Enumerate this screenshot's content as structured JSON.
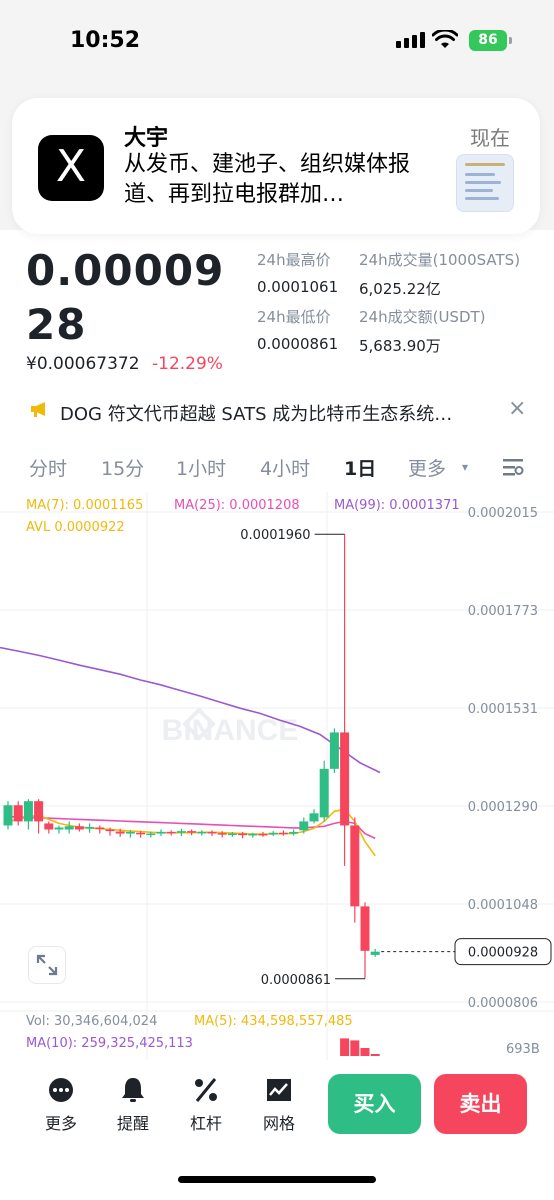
{
  "status": {
    "time": "10:52",
    "battery": "86"
  },
  "notification": {
    "app_logo": "X",
    "title": "大宇",
    "time": "现在",
    "body": "从发币、建池子、组织媒体报道、再到拉电报群加…"
  },
  "price": {
    "main": "0.0000928",
    "cny": "¥0.00067372",
    "change": "-12.29%"
  },
  "stats": {
    "high_label": "24h最高价",
    "high_value": "0.0001061",
    "vol_label": "24h成交量(1000SATS)",
    "vol_value": "6,025.22亿",
    "low_label": "24h最低价",
    "low_value": "0.0000861",
    "turnover_label": "24h成交额(USDT)",
    "turnover_value": "5,683.90万"
  },
  "news": {
    "text": "DOG 符文代币超越 SATS 成为比特币生态系统…",
    "close": "×"
  },
  "tabs": [
    {
      "label": "分时"
    },
    {
      "label": "15分"
    },
    {
      "label": "1小时"
    },
    {
      "label": "4小时"
    },
    {
      "label": "1日"
    },
    {
      "label": "更多"
    }
  ],
  "legend": {
    "ma7": "MA(7): 0.0001165",
    "ma25": "MA(25): 0.0001208",
    "ma99": "MA(99): 0.0001371",
    "avl": "AVL 0.0000922",
    "vol": "Vol: 30,346,604,024",
    "vol_ma5": "MA(5): 434,598,557,485",
    "vol_ma10": "MA(10): 259,325,425,113",
    "vol_axis": "693B"
  },
  "colors": {
    "up": "#2ebd85",
    "down": "#f6465d",
    "ma7": "#f0b90b",
    "ma25": "#e84fb3",
    "ma99": "#9b59d0"
  },
  "chart_data": {
    "type": "candlestick",
    "watermark": "BINANCE",
    "y_ticks": [
      "0.0002015",
      "0.0001773",
      "0.0001531",
      "0.0001290",
      "0.0001048",
      "0.0000806"
    ],
    "ylim": [
      8.06e-05,
      0.0002015
    ],
    "annotations": {
      "high": "0.0001960",
      "low": "0.0000861",
      "last": "0.0000928"
    },
    "candles": [
      {
        "o": 0.000124,
        "c": 0.000129,
        "h": 0.00013,
        "l": 0.000123
      },
      {
        "o": 0.000129,
        "c": 0.000125,
        "h": 0.00013,
        "l": 0.000124
      },
      {
        "o": 0.000125,
        "c": 0.00013,
        "h": 0.0001305,
        "l": 0.000123
      },
      {
        "o": 0.00013,
        "c": 0.000125,
        "h": 0.0001305,
        "l": 0.000122
      },
      {
        "o": 0.0001245,
        "c": 0.000123,
        "h": 0.000125,
        "l": 0.000122
      },
      {
        "o": 0.000123,
        "c": 0.0001235,
        "h": 0.000124,
        "l": 0.000122
      },
      {
        "o": 0.000123,
        "c": 0.0001238,
        "h": 0.000125,
        "l": 0.000122
      },
      {
        "o": 0.0001238,
        "c": 0.000123,
        "h": 0.0001245,
        "l": 0.0001225
      },
      {
        "o": 0.0001232,
        "c": 0.0001236,
        "h": 0.0001245,
        "l": 0.0001222
      },
      {
        "o": 0.0001235,
        "c": 0.0001232,
        "h": 0.000124,
        "l": 0.000122
      },
      {
        "o": 0.000123,
        "c": 0.0001226,
        "h": 0.0001235,
        "l": 0.0001215
      },
      {
        "o": 0.0001225,
        "c": 0.000122,
        "h": 0.0001232,
        "l": 0.0001212
      },
      {
        "o": 0.000122,
        "c": 0.0001224,
        "h": 0.0001228,
        "l": 0.000121
      },
      {
        "o": 0.0001222,
        "c": 0.0001218,
        "h": 0.0001226,
        "l": 0.000121
      },
      {
        "o": 0.0001218,
        "c": 0.000122,
        "h": 0.0001225,
        "l": 0.000121
      },
      {
        "o": 0.000122,
        "c": 0.0001224,
        "h": 0.000123,
        "l": 0.0001214
      },
      {
        "o": 0.0001224,
        "c": 0.0001222,
        "h": 0.0001228,
        "l": 0.0001215
      },
      {
        "o": 0.0001222,
        "c": 0.0001226,
        "h": 0.0001232,
        "l": 0.0001214
      },
      {
        "o": 0.0001226,
        "c": 0.0001223,
        "h": 0.000123,
        "l": 0.0001216
      },
      {
        "o": 0.0001222,
        "c": 0.0001224,
        "h": 0.0001228,
        "l": 0.0001215
      },
      {
        "o": 0.0001224,
        "c": 0.0001221,
        "h": 0.0001228,
        "l": 0.0001214
      },
      {
        "o": 0.0001221,
        "c": 0.0001218,
        "h": 0.0001226,
        "l": 0.000121
      },
      {
        "o": 0.0001218,
        "c": 0.000122,
        "h": 0.0001224,
        "l": 0.0001212
      },
      {
        "o": 0.000122,
        "c": 0.0001216,
        "h": 0.0001224,
        "l": 0.0001208
      },
      {
        "o": 0.0001216,
        "c": 0.0001219,
        "h": 0.0001222,
        "l": 0.000121
      },
      {
        "o": 0.0001219,
        "c": 0.0001218,
        "h": 0.0001224,
        "l": 0.0001212
      },
      {
        "o": 0.0001218,
        "c": 0.0001222,
        "h": 0.0001226,
        "l": 0.0001214
      },
      {
        "o": 0.0001222,
        "c": 0.000122,
        "h": 0.0001228,
        "l": 0.0001215
      },
      {
        "o": 0.000122,
        "c": 0.0001224,
        "h": 0.000123,
        "l": 0.0001215
      },
      {
        "o": 0.0001228,
        "c": 0.000125,
        "h": 0.000126,
        "l": 0.000122
      },
      {
        "o": 0.000125,
        "c": 0.000127,
        "h": 0.000128,
        "l": 0.0001245
      },
      {
        "o": 0.000126,
        "c": 0.000138,
        "h": 0.00014,
        "l": 0.000125
      },
      {
        "o": 0.000138,
        "c": 0.000147,
        "h": 0.000148,
        "l": 0.000137
      },
      {
        "o": 0.000147,
        "c": 0.000124,
        "h": 0.000196,
        "l": 0.000114
      },
      {
        "o": 0.000124,
        "c": 0.000104,
        "h": 0.000126,
        "l": 0.0001
      },
      {
        "o": 0.000104,
        "c": 9.3e-05,
        "h": 0.000105,
        "l": 8.61e-05
      },
      {
        "o": 9.2e-05,
        "c": 9.28e-05,
        "h": 9.35e-05,
        "l": 9.15e-05
      }
    ],
    "ma7": [
      0.000125,
      0.0001255,
      0.0001262,
      0.0001265,
      0.0001255,
      0.0001245,
      0.000124,
      0.0001236,
      0.0001234,
      0.0001232,
      0.000123,
      0.0001228,
      0.0001226,
      0.0001225,
      0.0001223,
      0.0001222,
      0.0001222,
      0.0001222,
      0.0001222,
      0.0001223,
      0.0001223,
      0.0001222,
      0.0001221,
      0.000122,
      0.0001219,
      0.0001219,
      0.0001219,
      0.000122,
      0.000122,
      0.0001225,
      0.0001233,
      0.000125,
      0.0001275,
      0.000128,
      0.000125,
      0.00012,
      0.0001165
    ],
    "ma25": [
      0.0001262,
      0.0001261,
      0.000126,
      0.0001259,
      0.0001258,
      0.0001257,
      0.0001256,
      0.0001255,
      0.0001254,
      0.0001253,
      0.0001252,
      0.0001251,
      0.000125,
      0.0001249,
      0.0001248,
      0.0001247,
      0.0001246,
      0.0001245,
      0.0001244,
      0.0001243,
      0.0001242,
      0.0001241,
      0.000124,
      0.0001239,
      0.0001238,
      0.0001237,
      0.0001236,
      0.0001235,
      0.0001234,
      0.0001234,
      0.0001236,
      0.0001238,
      0.0001245,
      0.000125,
      0.0001245,
      0.000122,
      0.0001208
    ],
    "ma99_x": [
      0,
      20,
      40,
      60,
      80,
      100,
      120,
      140,
      160,
      180,
      200,
      220,
      240,
      260,
      280,
      300,
      320,
      340,
      360,
      380
    ],
    "ma99_y": [
      0.000168,
      0.000167,
      0.000166,
      0.0001648,
      0.0001636,
      0.0001625,
      0.0001614,
      0.00016,
      0.0001588,
      0.0001574,
      0.000156,
      0.0001545,
      0.000153,
      0.0001517,
      0.00015,
      0.0001485,
      0.0001465,
      0.000143,
      0.0001395,
      0.0001371
    ],
    "volumes_last": [
      0.88,
      0.78,
      0.4,
      0.1
    ]
  },
  "bottom": {
    "items": [
      {
        "label": "更多"
      },
      {
        "label": "提醒"
      },
      {
        "label": "杠杆"
      },
      {
        "label": "网格"
      }
    ],
    "buy": "买入",
    "sell": "卖出"
  }
}
